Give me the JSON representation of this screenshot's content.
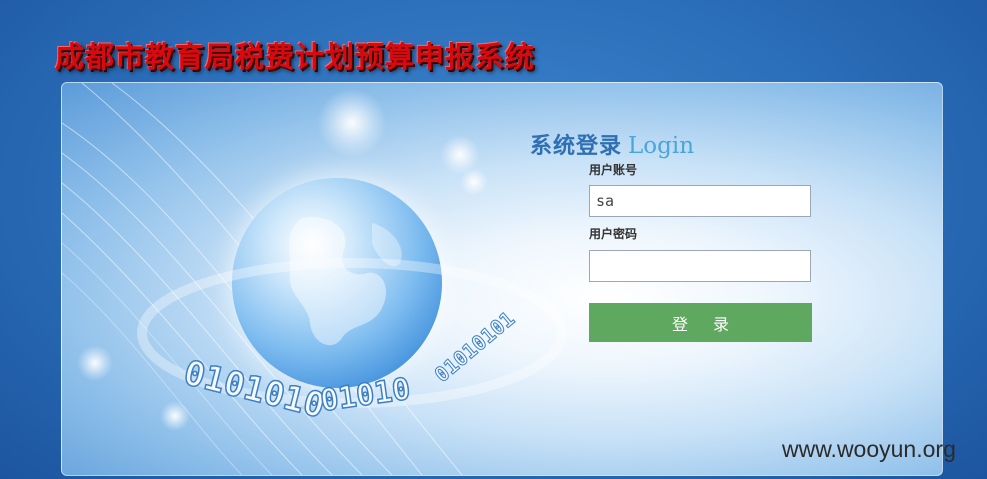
{
  "app": {
    "title": "成都市教育局税费计划预算申报系统"
  },
  "login": {
    "heading_cn": "系统登录",
    "heading_en": "Login",
    "username_label": "用户账号",
    "username_value": "sa",
    "password_label": "用户密码",
    "password_value": "",
    "submit_label": "登 录"
  },
  "watermark": {
    "text": "www.wooyun.org"
  },
  "colors": {
    "title_red": "#d8090f",
    "button_green": "#5fa85f",
    "background_blue": "#2a6db8"
  },
  "decor": {
    "globe_icon": "globe-icon",
    "binary_ring": "binary-ring"
  }
}
